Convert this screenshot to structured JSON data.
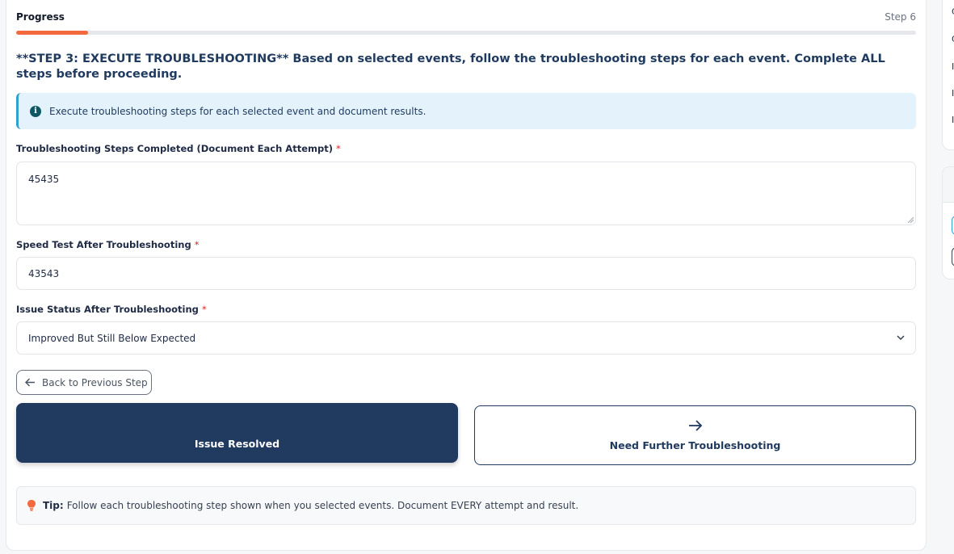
{
  "progress": {
    "title": "Progress",
    "step_label": "Step 6",
    "fraction": 0.08,
    "bar_color": "#f26a3d"
  },
  "step_heading": "**STEP 3: EXECUTE TROUBLESHOOTING** Based on selected events, follow the troubleshooting steps for each event. Complete ALL steps before proceeding.",
  "info_alert": {
    "icon": "info-circle-icon",
    "text": "Execute troubleshooting steps for each selected event and document results."
  },
  "fields": {
    "steps_completed": {
      "label": "Troubleshooting Steps Completed (Document Each Attempt)",
      "required_mark": "*",
      "value": "45435"
    },
    "speed_test": {
      "label": "Speed Test After Troubleshooting",
      "required_mark": "*",
      "value": "43543"
    },
    "issue_status": {
      "label": "Issue Status After Troubleshooting",
      "required_mark": "*",
      "value": "Improved But Still Below Expected"
    }
  },
  "buttons": {
    "back": "Back to Previous Step",
    "resolved": "Issue Resolved",
    "further": "Need Further Troubleshooting"
  },
  "tip": {
    "icon": "lightbulb-icon",
    "strong": "Tip:",
    "text": "Follow each troubleshooting step shown when you selected events. Document EVERY attempt and result."
  },
  "side": {
    "glyphs": [
      "C",
      "C",
      "I",
      "I",
      "I"
    ]
  },
  "colors": {
    "primary": "#213a5f",
    "accent": "#f26a3d",
    "info_bg": "#e4f3fb",
    "info_border": "#2ea2cf",
    "required": "#dc2626"
  }
}
